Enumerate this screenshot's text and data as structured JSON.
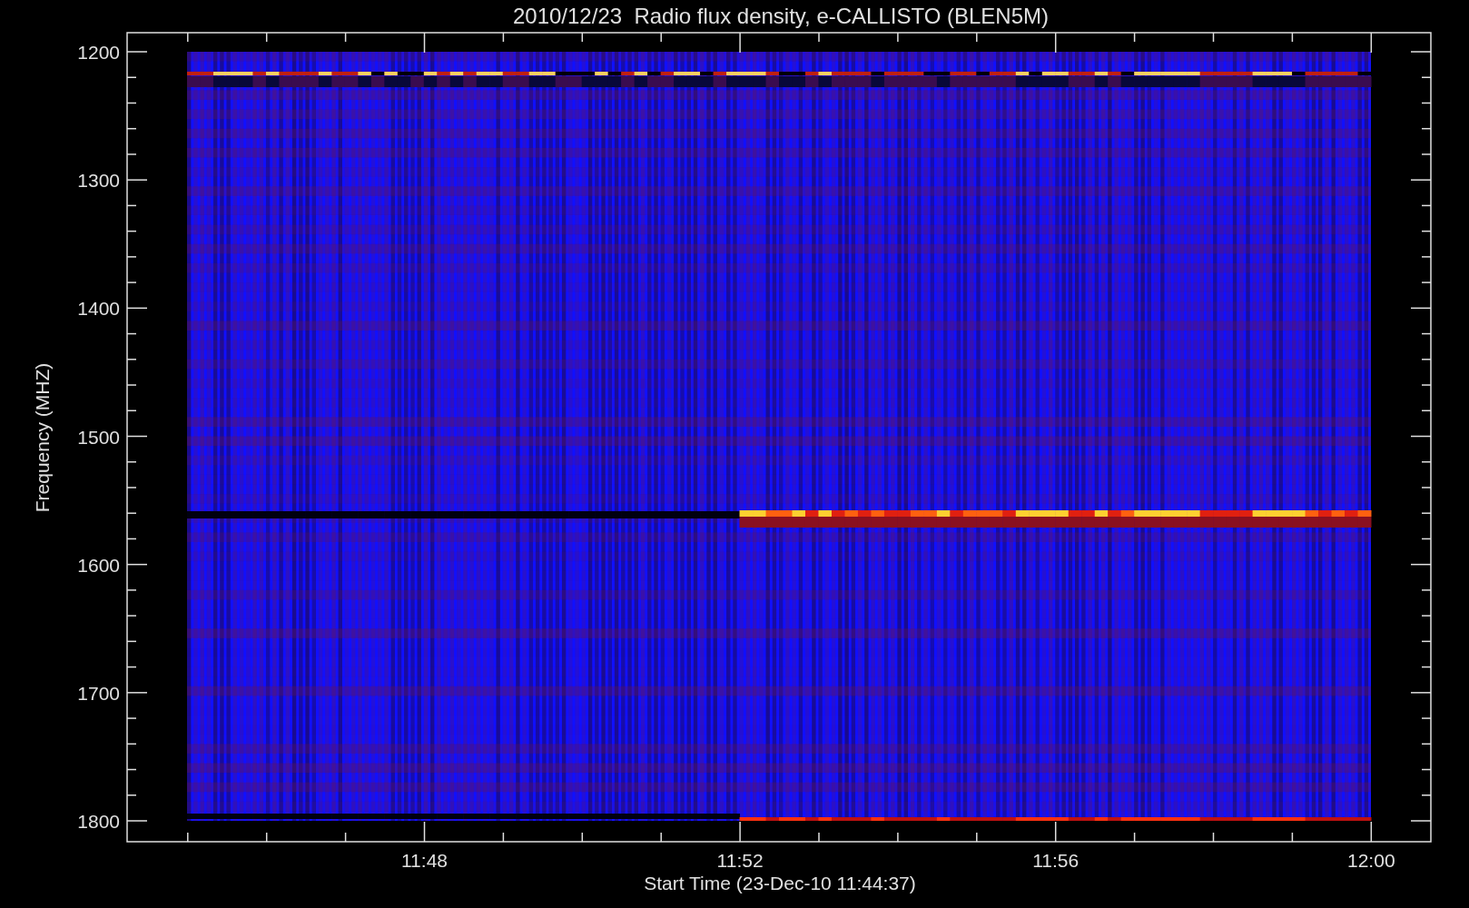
{
  "title": "2010/12/23  Radio flux density, e-CALLISTO (BLEN5M)",
  "plot": {
    "xlabel": "Start Time (23-Dec-10 11:44:37)",
    "ylabel": "Frequency (MHZ)",
    "xticks": [
      "11:48",
      "11:52",
      "11:56",
      "12:00"
    ],
    "yticks": [
      "1200",
      "1300",
      "1400",
      "1500",
      "1600",
      "1700",
      "1800"
    ]
  }
}
